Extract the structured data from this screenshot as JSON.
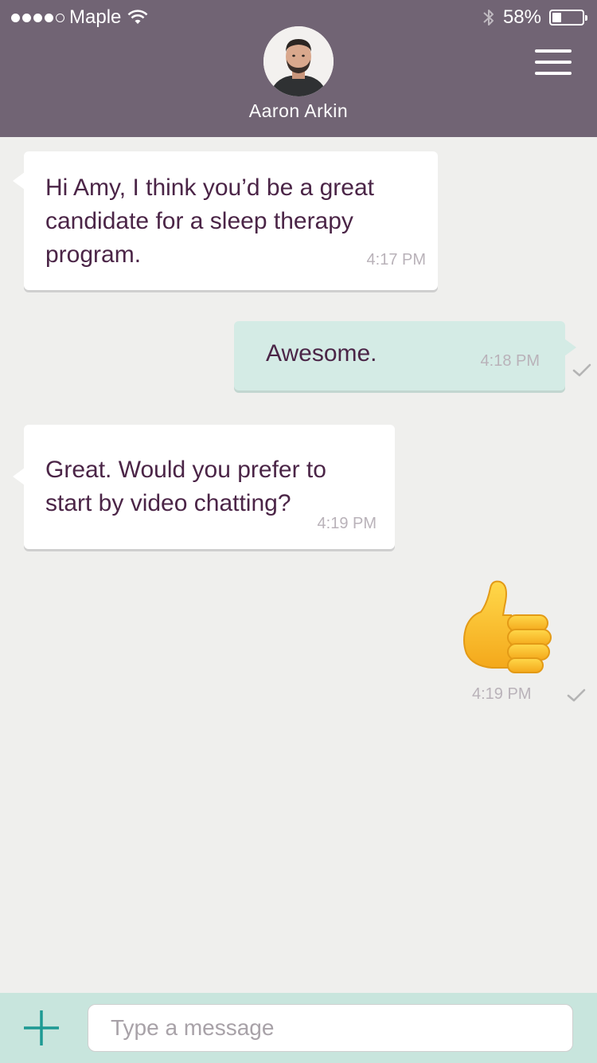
{
  "status_bar": {
    "carrier": "Maple",
    "battery_percent_label": "58%",
    "battery_level": 0.3,
    "signal_bars_filled": 4,
    "signal_bars_total": 5,
    "icons": [
      "wifi-icon",
      "bluetooth-icon",
      "battery-icon"
    ]
  },
  "header": {
    "contact_name": "Aaron Arkin",
    "avatar_icon": "contact-avatar",
    "menu_icon": "hamburger-menu-icon",
    "background_color": "#716474"
  },
  "messages": [
    {
      "direction": "incoming",
      "text": "Hi Amy, I think you’d be a great candidate for a sleep therapy program.",
      "time": "4:17 PM"
    },
    {
      "direction": "outgoing",
      "text": "Awesome.",
      "time": "4:18 PM",
      "delivered": true
    },
    {
      "direction": "incoming",
      "text": "Great. Would you prefer to start by video chatting?",
      "time": "4:19 PM"
    },
    {
      "direction": "outgoing",
      "type": "emoji",
      "emoji": "thumbs-up",
      "time": "4:19 PM",
      "delivered": true
    }
  ],
  "composer": {
    "add_icon": "plus-icon",
    "placeholder": "Type a message",
    "value": ""
  },
  "colors": {
    "incoming_bubble": "#ffffff",
    "outgoing_bubble": "#d4ebe5",
    "message_text": "#4b2547",
    "accent": "#1d9a93",
    "composer_bar": "#c8e5dd"
  }
}
